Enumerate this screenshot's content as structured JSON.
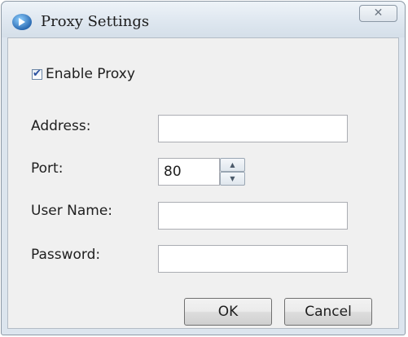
{
  "window": {
    "title": "Proxy Settings",
    "close_icon": "close-icon"
  },
  "form": {
    "enable_proxy": {
      "label": "Enable Proxy",
      "checked": true
    },
    "address": {
      "label": "Address:",
      "value": ""
    },
    "port": {
      "label": "Port:",
      "value": "80"
    },
    "user_name": {
      "label": "User Name:",
      "value": ""
    },
    "password": {
      "label": "Password:",
      "value": ""
    }
  },
  "buttons": {
    "ok": "OK",
    "cancel": "Cancel"
  },
  "icons": {
    "app": "app-icon",
    "check": "check-icon",
    "spin_up": "chevron-up-icon",
    "spin_down": "chevron-down-icon"
  },
  "colors": {
    "accent": "#2a50a0",
    "window_frame": "#dce5ee",
    "client_bg": "#f0f0f0"
  }
}
